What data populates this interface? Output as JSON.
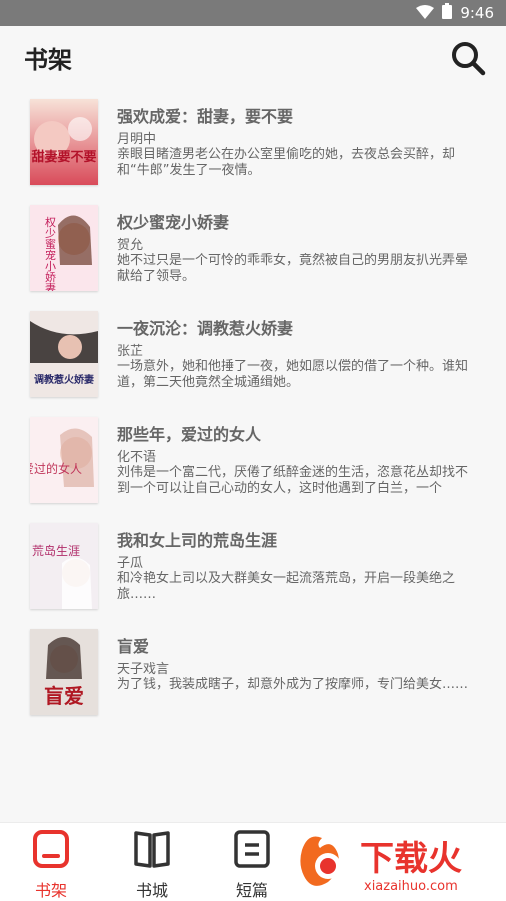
{
  "status_bar": {
    "time": "9:46"
  },
  "header": {
    "title": "书架"
  },
  "books": [
    {
      "title": "强欢成爱：甜妻，要不要",
      "author": "月明中",
      "desc": "亲眼目睹渣男老公在办公室里偷吃的她，去夜总会买醉，却和“牛郎”发生了一夜情。",
      "cover_text": "甜妻要不要"
    },
    {
      "title": "权少蜜宠小娇妻",
      "author": "贺允",
      "desc": "她不过只是一个可怜的乖乖女，竟然被自己的男朋友扒光弄晕献给了领导。",
      "cover_text": "权少蜜宠小娇妻"
    },
    {
      "title": "一夜沉沦：调教惹火娇妻",
      "author": "张芷",
      "desc": "一场意外，她和他捶了一夜，她如愿以偿的借了一个种。谁知道，第二天他竟然全城通缉她。",
      "cover_text": "调教惹火娇妻"
    },
    {
      "title": "那些年，爱过的女人",
      "author": "化不语",
      "desc": "刘伟是一个富二代，厌倦了纸醉金迷的生活，恣意花丛却找不到一个可以让自己心动的女人，这时他遇到了白兰，一个",
      "cover_text": "爱过的女人"
    },
    {
      "title": "我和女上司的荒岛生涯",
      "author": "子瓜",
      "desc": "和冷艳女上司以及大群美女一起流落荒岛，开启一段美绝之旅……",
      "cover_text": "荒岛生涯"
    },
    {
      "title": "盲爱",
      "author": "天子戏言",
      "desc": "为了钱，我装成瞎子，却意外成为了按摩师，专门给美女……",
      "cover_text": "盲爱"
    }
  ],
  "tabs": [
    {
      "label": "书架",
      "icon": "bookshelf-icon",
      "active": true
    },
    {
      "label": "书城",
      "icon": "book-open-icon",
      "active": false
    },
    {
      "label": "短篇",
      "icon": "short-story-icon",
      "active": false
    }
  ],
  "watermark": {
    "brand": "下载火",
    "url": "xiazaihuo.com"
  },
  "colors": {
    "accent": "#e8332d",
    "status_bar": "#7a7a7a",
    "text": "#666666"
  }
}
